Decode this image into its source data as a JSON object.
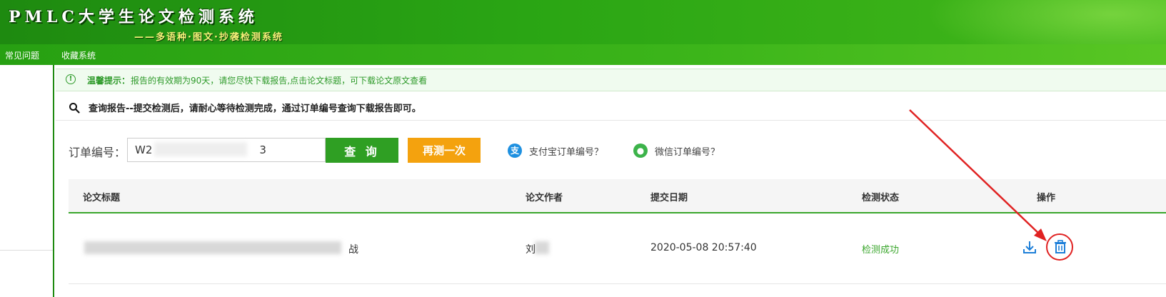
{
  "header": {
    "title": "PMLC大学生论文检测系统",
    "subtitle": "——多语种·图文·抄袭检测系统"
  },
  "nav": {
    "items": [
      {
        "label": "常见问题"
      },
      {
        "label": "收藏系统"
      }
    ]
  },
  "notice": {
    "label": "温馨提示：",
    "text": "报告的有效期为90天，请您尽快下载报告,点击论文标题，可下载论文原文查看"
  },
  "query": {
    "text": "查询报告--提交检测后，请耐心等待检测完成，通过订单编号查询下载报告即可。"
  },
  "order": {
    "label": "订单编号：",
    "value": "W2",
    "value_suffix": "3",
    "query_button": "查 询",
    "retest_button": "再测一次",
    "alipay_link": "支付宝订单编号？",
    "wechat_link": "微信订单编号？"
  },
  "table": {
    "columns": [
      "论文标题",
      "论文作者",
      "提交日期",
      "检测状态",
      "操作"
    ],
    "rows": [
      {
        "title_suffix": "战",
        "author": "刘",
        "date": "2020-05-08 20:57:40",
        "status": "检测成功"
      }
    ]
  },
  "colors": {
    "brand_green": "#2f9f23",
    "accent_orange": "#f4a20e",
    "status_success": "#3aa62c",
    "action_blue": "#1e7fd8",
    "annotation_red": "#e02222"
  },
  "icons": {
    "notice": "info-circle-icon",
    "query": "search-icon",
    "alipay": "alipay-icon",
    "wechat": "wechat-icon",
    "download": "download-icon",
    "delete": "trash-icon"
  }
}
